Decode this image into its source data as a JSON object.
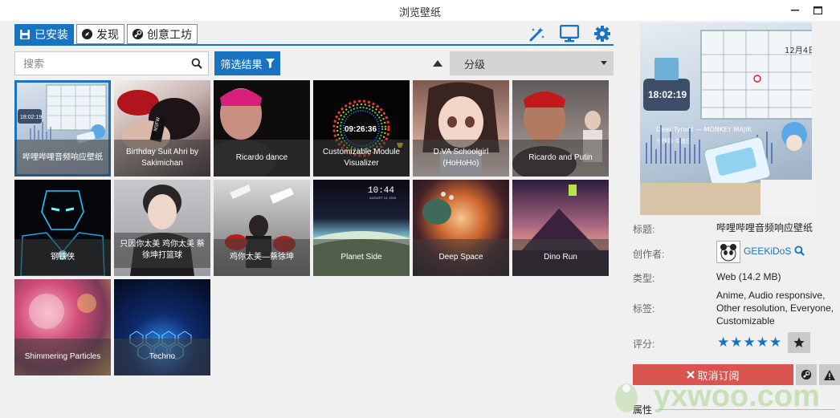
{
  "window": {
    "title": "浏览壁纸"
  },
  "tabs": [
    {
      "label": "已安装",
      "icon": "floppy-disk-icon",
      "active": true
    },
    {
      "label": "发现",
      "icon": "compass-icon",
      "active": false
    },
    {
      "label": "创意工坊",
      "icon": "steam-icon",
      "active": false
    }
  ],
  "toolbar": {
    "edit_icon": "wand-icon",
    "display_icon": "monitor-icon",
    "settings_icon": "gear-icon"
  },
  "search": {
    "placeholder": "搜索"
  },
  "filter": {
    "label": "筛选结果"
  },
  "sort": {
    "selected": "分级"
  },
  "wallpapers": [
    {
      "title": "哔哩哔哩音频响应壁纸"
    },
    {
      "title": "Birthday Suit Ahri by Sakimichan"
    },
    {
      "title": "Ricardo dance"
    },
    {
      "title": "Customizable Module Visualizer"
    },
    {
      "title": "D.VA Schoolgirl (HoHoHo)"
    },
    {
      "title": "Ricardo and Putin"
    },
    {
      "title": "钢铁侠"
    },
    {
      "title": "只因你太美 鸡你太美 蔡徐坤打篮球"
    },
    {
      "title": "鸡你太美—蔡徐坤"
    },
    {
      "title": "Planet Side"
    },
    {
      "title": "Deep Space"
    },
    {
      "title": "Dino Run"
    },
    {
      "title": "Shimmering Particles"
    },
    {
      "title": "Techno"
    }
  ],
  "preview": {
    "clock": "18:02:19",
    "date": "12月4日",
    "banner": "Dear Tyrant — MONKEY MAJIK",
    "lyric": "七秒春·今夜日"
  },
  "details": {
    "title_label": "标题:",
    "title_value": "哔哩哔哩音频响应壁纸",
    "author_label": "创作者:",
    "author_value": "GEEKiDoS",
    "type_label": "类型:",
    "type_value": "Web (14.2 MB)",
    "tags_label": "标签:",
    "tags_value": [
      "Anime, Audio responsive,",
      "Other resolution, Everyone,",
      "Customizable"
    ],
    "rating_label": "评分:",
    "rating_stars": "★★★★★",
    "unsubscribe_label": "取消订阅",
    "properties_label": "属性"
  },
  "watermark": {
    "text": "yxwoo.com"
  },
  "colors": {
    "accent": "#1a73c1",
    "danger": "#d9534f"
  }
}
